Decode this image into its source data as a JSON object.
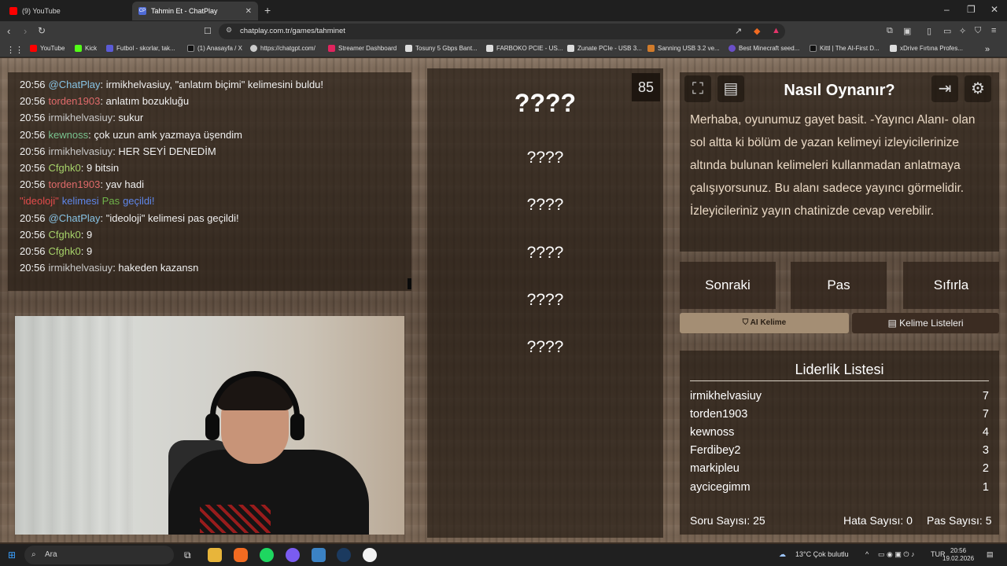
{
  "browser": {
    "tabs": [
      {
        "title": "(9) YouTube",
        "active": false,
        "icon": "youtube-icon"
      },
      {
        "title": "Tahmin Et - ChatPlay",
        "active": true,
        "icon": "chatplay-icon"
      }
    ],
    "url": "chatplay.com.tr/games/tahminet",
    "bookmarks": [
      {
        "label": "YouTube",
        "color": "#ff0000"
      },
      {
        "label": "Kick",
        "color": "#53fc18"
      },
      {
        "label": "Futbol - skorlar, tak...",
        "color": "#5b5bd6"
      },
      {
        "label": "(1) Anasayfa / X",
        "color": "#111111"
      },
      {
        "label": "https://chatgpt.com/",
        "color": "#cccccc"
      },
      {
        "label": "Streamer Dashboard",
        "color": "#e0245e"
      },
      {
        "label": "Tosuny 5 Gbps Bant...",
        "color": "#dddddd"
      },
      {
        "label": "FARBOKO PCIE - US...",
        "color": "#dddddd"
      },
      {
        "label": "Zunate PCIe - USB 3...",
        "color": "#dddddd"
      },
      {
        "label": "Sanning USB 3.2 ve...",
        "color": "#d17b2b"
      },
      {
        "label": "Best Minecraft seed...",
        "color": "#6a4fc8"
      },
      {
        "label": "Kittl | The AI-First D...",
        "color": "#111111"
      },
      {
        "label": "xDrive Fırtına Profes...",
        "color": "#dddddd"
      }
    ]
  },
  "chat": [
    {
      "time": "20:56",
      "user": "@ChatPlay",
      "ucls": "u-chatplay",
      "msg": ": irmikhelvasiuy, \"anlatım biçimi\" kelimesini buldu!"
    },
    {
      "time": "20:56",
      "user": "torden1903",
      "ucls": "u-torden",
      "msg": ": anlatım bozukluğu"
    },
    {
      "time": "20:56",
      "user": "irmikhelvasiuy",
      "ucls": "u-irmik",
      "msg": ": sukur"
    },
    {
      "time": "20:56",
      "user": "kewnoss",
      "ucls": "u-kewnoss",
      "msg": ": çok uzun amk yazmaya üşendim"
    },
    {
      "time": "20:56",
      "user": "irmikhelvasiuy",
      "ucls": "u-irmik",
      "msg": ": HER SEYİ DENEDİM"
    },
    {
      "time": "20:56",
      "user": "Cfghk0",
      "ucls": "u-cfghk",
      "msg": ": 9 bitsin"
    },
    {
      "time": "20:56",
      "user": "torden1903",
      "ucls": "u-torden",
      "msg": ": yav hadi"
    },
    {
      "time": "",
      "system": true,
      "w1": "\"ideoloji\"",
      "w2": "kelimesi",
      "w3": "Pas",
      "w4": "geçildi!"
    },
    {
      "time": "20:56",
      "user": "@ChatPlay",
      "ucls": "u-chatplay",
      "msg": ": \"ideoloji\" kelimesi pas geçildi!"
    },
    {
      "time": "20:56",
      "user": "Cfghk0",
      "ucls": "u-cfghk",
      "msg": ": 9"
    },
    {
      "time": "20:56",
      "user": "Cfghk0",
      "ucls": "u-cfghk",
      "msg": ": 9"
    },
    {
      "time": "20:56",
      "user": "irmikhelvasiuy",
      "ucls": "u-irmik",
      "msg": ": hakeden kazansn"
    }
  ],
  "game": {
    "timer": "85",
    "main_word": "????",
    "forbidden": [
      "????",
      "????",
      "????",
      "????",
      "????"
    ]
  },
  "howto": {
    "title": "Nasıl Oynanır?",
    "text": "Merhaba, oyunumuz gayet basit. -Yayıncı Alanı- olan sol altta ki bölüm de yazan kelimeyi izleyicilerinize altında bulunan kelimeleri kullanmadan anlatmaya çalışıyorsunuz. Bu alanı sadece yayıncı görmelidir. İzleyicileriniz yayın chatinizde cevap verebilir."
  },
  "buttons": {
    "next": "Sonraki",
    "pass": "Pas",
    "reset": "Sıfırla",
    "ai_word": "AI Kelime",
    "word_lists": "Kelime Listeleri"
  },
  "leaderboard": {
    "title": "Liderlik Listesi",
    "rows": [
      {
        "name": "irmikhelvasiuy",
        "score": "7"
      },
      {
        "name": "torden1903",
        "score": "7"
      },
      {
        "name": "kewnoss",
        "score": "4"
      },
      {
        "name": "Ferdibey2",
        "score": "3"
      },
      {
        "name": "markipleu",
        "score": "2"
      },
      {
        "name": "aycicegimm",
        "score": "1"
      }
    ]
  },
  "stats": {
    "questions": "Soru Sayısı: 25",
    "errors": "Hata Sayısı: 0",
    "passes": "Pas Sayısı: 5"
  },
  "taskbar": {
    "search": "Ara",
    "weather": "13°C  Çok bulutlu",
    "lang": "TUR",
    "time": "20:56",
    "date": "19.02.2026"
  }
}
